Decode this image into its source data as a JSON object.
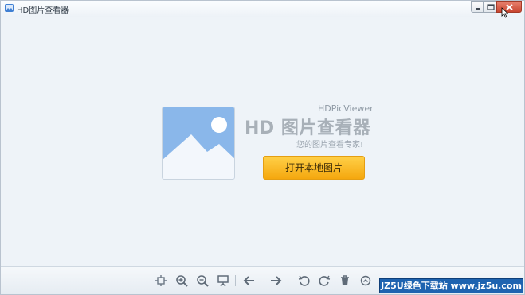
{
  "window": {
    "title": "HD图片查看器"
  },
  "welcome": {
    "brand_en": "HDPicViewer",
    "brand_cn": "HD 图片查看器",
    "tagline": "您的图片查看专家!",
    "open_button_label": "打开本地图片"
  },
  "toolbar": {
    "items": [
      {
        "icon": "fit-window-icon"
      },
      {
        "icon": "zoom-in-icon"
      },
      {
        "icon": "zoom-out-icon"
      },
      {
        "icon": "slideshow-icon"
      },
      {
        "icon": "arrow-left-icon"
      },
      {
        "icon": "arrow-right-icon"
      },
      {
        "icon": "rotate-left-icon"
      },
      {
        "icon": "rotate-right-icon"
      },
      {
        "icon": "delete-icon"
      },
      {
        "icon": "more-icon"
      }
    ]
  },
  "watermark": {
    "text": "JZ5U绿色下载站 www.jz5u.com"
  },
  "colors": {
    "accent_button": "#f5a70e",
    "close_button": "#c84530",
    "background": "#eef3f8"
  }
}
